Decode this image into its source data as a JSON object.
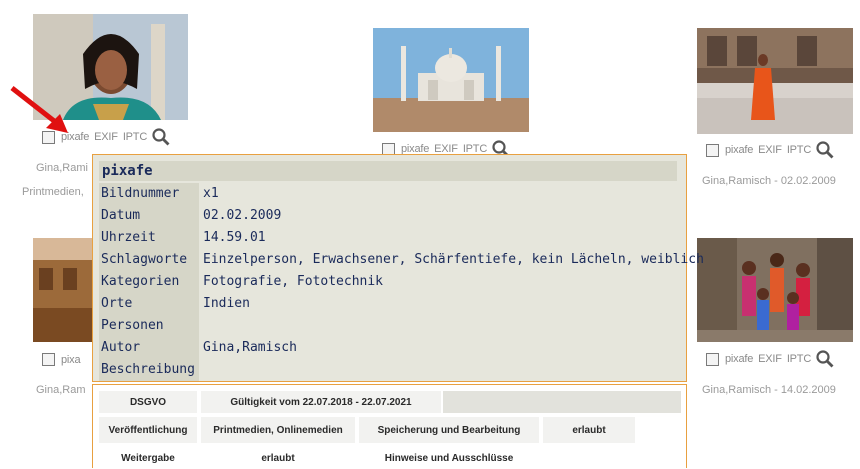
{
  "colors": {
    "accent": "#e8a040",
    "label_bg": "#d6d6c8",
    "popup_bg": "#e6e6dc",
    "text": "#1a2a5a",
    "arrow": "#e01010"
  },
  "toolbar": {
    "checkbox": "checkbox",
    "source": "pixafe",
    "exif": "EXIF",
    "iptc": "IPTC",
    "zoom_icon": "magnifier-icon"
  },
  "captions": {
    "top_left_line1": "Gina,Rami",
    "top_left_line2": "Printmedien,",
    "top_right": "Gina,Ramisch - 02.02.2009",
    "bottom_left": "Gina,Ram",
    "bottom_right": "Gina,Ramisch - 14.02.2009",
    "partial_source_left": "pixa"
  },
  "popup": {
    "title": "pixafe",
    "rows": [
      {
        "label": "Bildnummer",
        "value": "x1"
      },
      {
        "label": "Datum",
        "value": "02.02.2009"
      },
      {
        "label": "Uhrzeit",
        "value": "14.59.01"
      },
      {
        "label": "Schlagworte",
        "value": "Einzelperson, Erwachsener, Schärfentiefe, kein Lächeln, weiblich"
      },
      {
        "label": "Kategorien",
        "value": "Fotografie, Fototechnik"
      },
      {
        "label": "Orte",
        "value": "Indien"
      },
      {
        "label": "Personen",
        "value": ""
      },
      {
        "label": "Autor",
        "value": "Gina,Ramisch"
      },
      {
        "label": "Beschreibung",
        "value": ""
      }
    ]
  },
  "license": {
    "dsgvo": "DSGVO",
    "validity": "Gültigkeit vom 22.07.2018 - 22.07.2021",
    "publication": "Veröffentlichung",
    "media": "Printmedien, Onlinemedien",
    "storage": "Speicherung und Bearbeitung",
    "storage_value": "erlaubt",
    "transfer": "Weitergabe",
    "transfer_value": "erlaubt",
    "notes": "Hinweise und Ausschlüsse"
  }
}
